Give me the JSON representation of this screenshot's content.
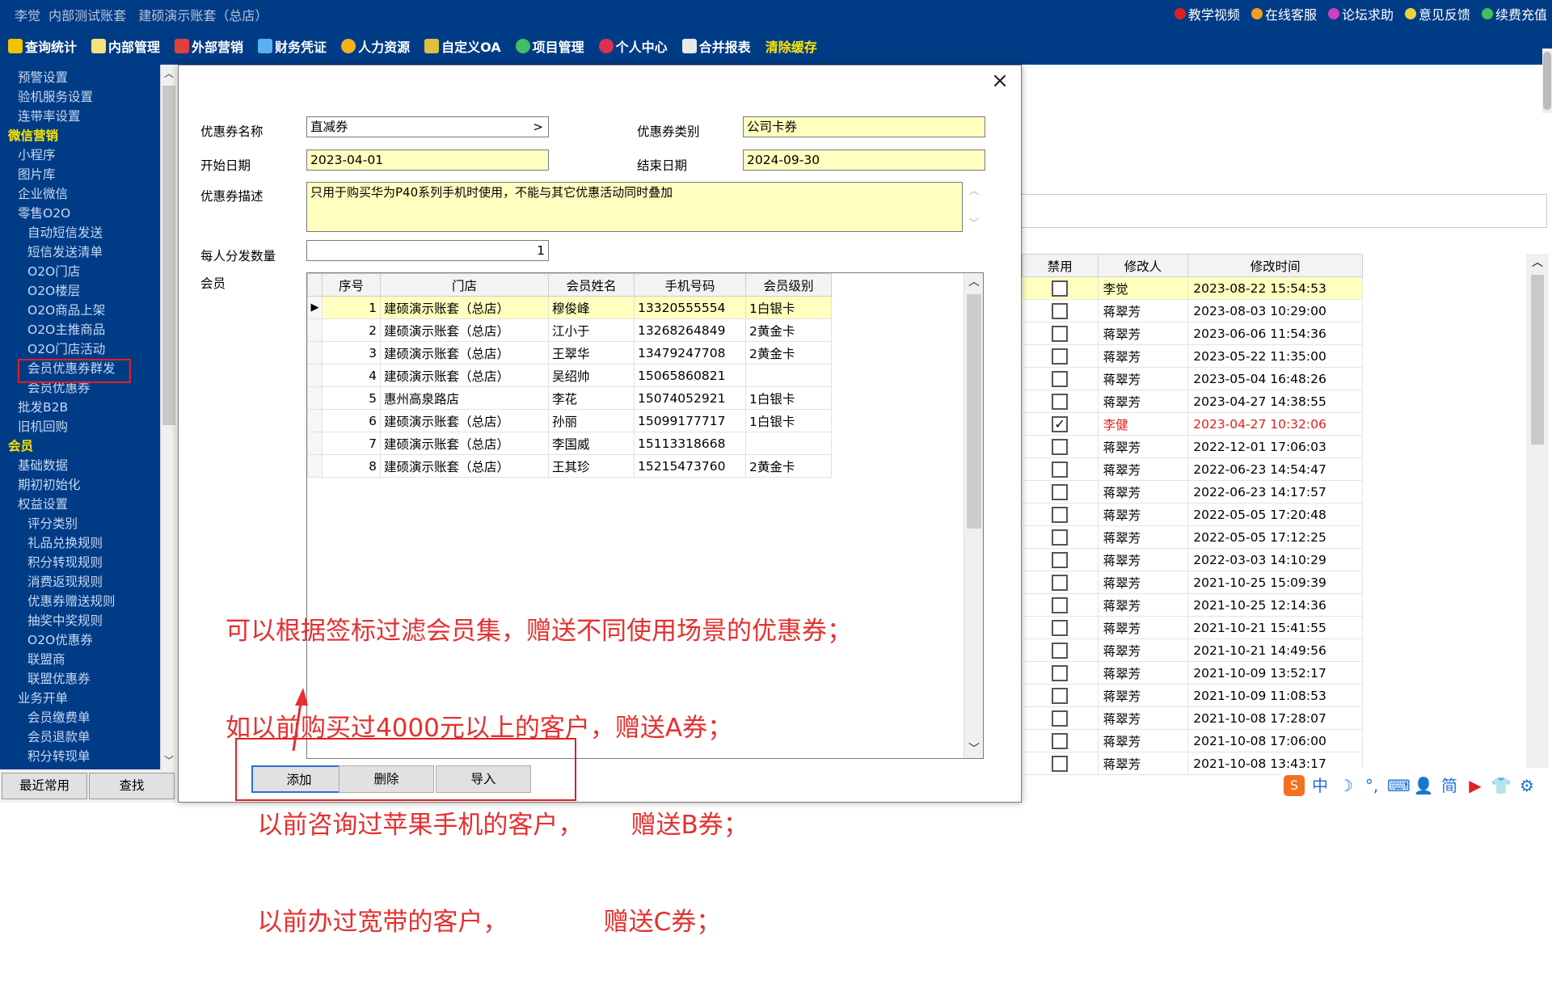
{
  "topbar": {
    "title": "李觉  内部测试账套   建硕演示账套（总店）",
    "links": [
      "教学视频",
      "在线客服",
      "论坛求助",
      "意见反馈",
      "续费充值"
    ]
  },
  "menu": [
    "查询统计",
    "内部管理",
    "外部营销",
    "财务凭证",
    "人力资源",
    "自定义OA",
    "项目管理",
    "个人中心",
    "合并报表",
    "清除缓存"
  ],
  "sidebar": {
    "items": [
      {
        "label": "预警设置",
        "level": 1
      },
      {
        "label": "验机服务设置",
        "level": 1
      },
      {
        "label": "连带率设置",
        "level": 1
      },
      {
        "label": "微信营销",
        "level": 0
      },
      {
        "label": "小程序",
        "level": 1
      },
      {
        "label": "图片库",
        "level": 1
      },
      {
        "label": "企业微信",
        "level": 1
      },
      {
        "label": "零售O2O",
        "level": 1
      },
      {
        "label": "自动短信发送",
        "level": 2
      },
      {
        "label": "短信发送清单",
        "level": 2
      },
      {
        "label": "O2O门店",
        "level": 2
      },
      {
        "label": "O2O楼层",
        "level": 2
      },
      {
        "label": "O2O商品上架",
        "level": 2
      },
      {
        "label": "O2O主推商品",
        "level": 2
      },
      {
        "label": "O2O门店活动",
        "level": 2
      },
      {
        "label": "会员优惠券群发",
        "level": 2
      },
      {
        "label": "会员优惠券",
        "level": 2
      },
      {
        "label": "批发B2B",
        "level": 1
      },
      {
        "label": "旧机回购",
        "level": 1
      },
      {
        "label": "会员",
        "level": 0
      },
      {
        "label": "基础数据",
        "level": 1
      },
      {
        "label": "期初初始化",
        "level": 1
      },
      {
        "label": "权益设置",
        "level": 1
      },
      {
        "label": "评分类别",
        "level": 2
      },
      {
        "label": "礼品兑换规则",
        "level": 2
      },
      {
        "label": "积分转现规则",
        "level": 2
      },
      {
        "label": "消费返现规则",
        "level": 2
      },
      {
        "label": "优惠券赠送规则",
        "level": 2
      },
      {
        "label": "抽奖中奖规则",
        "level": 2
      },
      {
        "label": "O2O优惠券",
        "level": 2
      },
      {
        "label": "联盟商",
        "level": 2
      },
      {
        "label": "联盟优惠券",
        "level": 2
      },
      {
        "label": "业务开单",
        "level": 1
      },
      {
        "label": "会员缴费单",
        "level": 2
      },
      {
        "label": "会员退款单",
        "level": 2
      },
      {
        "label": "积分转现单",
        "level": 2
      }
    ],
    "bottom_tabs": [
      "最近常用",
      "查找"
    ]
  },
  "background_table": {
    "headers": [
      "禁用",
      "修改人",
      "修改时间"
    ],
    "rows": [
      {
        "disabled": false,
        "modifier": "李觉",
        "time": "2023-08-22 15:54:53"
      },
      {
        "disabled": false,
        "modifier": "蒋翠芳",
        "time": "2023-08-03 10:29:00"
      },
      {
        "disabled": false,
        "modifier": "蒋翠芳",
        "time": "2023-06-06 11:54:36"
      },
      {
        "disabled": false,
        "modifier": "蒋翠芳",
        "time": "2023-05-22 11:35:00"
      },
      {
        "disabled": false,
        "modifier": "蒋翠芳",
        "time": "2023-05-04 16:48:26"
      },
      {
        "disabled": false,
        "modifier": "蒋翠芳",
        "time": "2023-04-27 14:38:55"
      },
      {
        "disabled": true,
        "modifier": "李健",
        "time": "2023-04-27 10:32:06"
      },
      {
        "disabled": false,
        "modifier": "蒋翠芳",
        "time": "2022-12-01 17:06:03"
      },
      {
        "disabled": false,
        "modifier": "蒋翠芳",
        "time": "2022-06-23 14:54:47"
      },
      {
        "disabled": false,
        "modifier": "蒋翠芳",
        "time": "2022-06-23 14:17:57"
      },
      {
        "disabled": false,
        "modifier": "蒋翠芳",
        "time": "2022-05-05 17:20:48"
      },
      {
        "disabled": false,
        "modifier": "蒋翠芳",
        "time": "2022-05-05 17:12:25"
      },
      {
        "disabled": false,
        "modifier": "蒋翠芳",
        "time": "2022-03-03 14:10:29"
      },
      {
        "disabled": false,
        "modifier": "蒋翠芳",
        "time": "2021-10-25 15:09:39"
      },
      {
        "disabled": false,
        "modifier": "蒋翠芳",
        "time": "2021-10-25 12:14:36"
      },
      {
        "disabled": false,
        "modifier": "蒋翠芳",
        "time": "2021-10-21 15:41:55"
      },
      {
        "disabled": false,
        "modifier": "蒋翠芳",
        "time": "2021-10-21 14:49:56"
      },
      {
        "disabled": false,
        "modifier": "蒋翠芳",
        "time": "2021-10-09 13:52:17"
      },
      {
        "disabled": false,
        "modifier": "蒋翠芳",
        "time": "2021-10-09 11:08:53"
      },
      {
        "disabled": false,
        "modifier": "蒋翠芳",
        "time": "2021-10-08 17:28:07"
      },
      {
        "disabled": false,
        "modifier": "蒋翠芳",
        "time": "2021-10-08 17:06:00"
      },
      {
        "disabled": false,
        "modifier": "蒋翠芳",
        "time": "2021-10-08 13:43:17"
      }
    ]
  },
  "modal": {
    "close": "×",
    "coupon_name_label": "优惠券名称",
    "coupon_name_value": "直减券",
    "coupon_name_arrow": ">",
    "coupon_type_label": "优惠券类别",
    "coupon_type_value": "公司卡券",
    "start_label": "开始日期",
    "start_value": "2023-04-01",
    "end_label": "结束日期",
    "end_value": "2024-09-30",
    "desc_label": "优惠券描述",
    "desc_value": "只用于购买华为P40系列手机时使用，不能与其它优惠活动同时叠加",
    "qty_label": "每人分发数量",
    "qty_value": "1",
    "member_label": "会员",
    "grid_headers": [
      "序号",
      "门店",
      "会员姓名",
      "手机号码",
      "会员级别"
    ],
    "grid_rows": [
      {
        "no": "1",
        "store": "建硕演示账套（总店）",
        "name": "穆俊峰",
        "phone": "13320555554",
        "level": "1白银卡"
      },
      {
        "no": "2",
        "store": "建硕演示账套（总店）",
        "name": "江小于",
        "phone": "13268264849",
        "level": "2黄金卡"
      },
      {
        "no": "3",
        "store": "建硕演示账套（总店）",
        "name": "王翠华",
        "phone": "13479247708",
        "level": "2黄金卡"
      },
      {
        "no": "4",
        "store": "建硕演示账套（总店）",
        "name": "吴绍帅",
        "phone": "15065860821",
        "level": ""
      },
      {
        "no": "5",
        "store": "惠州高泉路店",
        "name": "李花",
        "phone": "15074052921",
        "level": "1白银卡"
      },
      {
        "no": "6",
        "store": "建硕演示账套（总店）",
        "name": "孙丽",
        "phone": "15099177717",
        "level": "1白银卡"
      },
      {
        "no": "7",
        "store": "建硕演示账套（总店）",
        "name": "李国威",
        "phone": "15113318668",
        "level": ""
      },
      {
        "no": "8",
        "store": "建硕演示账套（总店）",
        "name": "王其珍",
        "phone": "15215473760",
        "level": "2黄金卡"
      }
    ],
    "annotation": [
      "可以根据签标过滤会员集，赠送不同使用场景的优惠券；",
      "如以前购买过4000元以上的客户，赠送A券；",
      "    以前咨询过苹果手机的客户，      赠送B券；",
      "    以前办过宽带的客户，            赠送C券；"
    ],
    "buttons": {
      "add": "添加",
      "delete": "删除",
      "import": "导入"
    }
  },
  "ime": {
    "logo": "S",
    "items": [
      "中",
      "☽",
      "°,",
      "⌨",
      "👤",
      "简",
      "▶",
      "👕",
      "⚙"
    ]
  },
  "colors": {
    "nav_bg": "#003c86",
    "highlight_yellow": "#ffffc0",
    "menu_yellow": "#ffe600",
    "annotation_red": "#e53030"
  }
}
